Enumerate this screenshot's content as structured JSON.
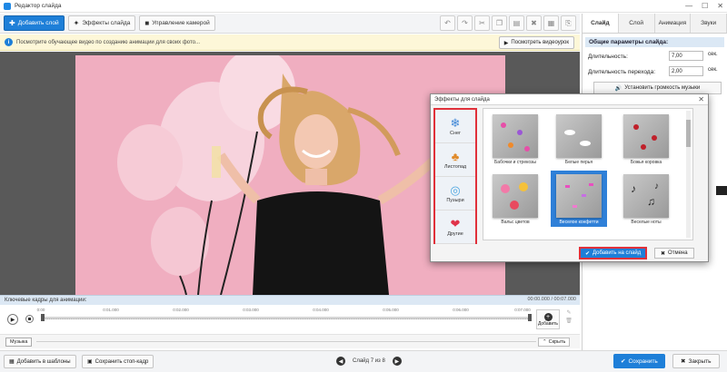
{
  "window": {
    "title": "Редактор слайда",
    "controls": [
      "—",
      "☐",
      "✕"
    ]
  },
  "toolbar": {
    "add_layer": "Добавить слой",
    "slide_effects": "Эффекты слайда",
    "camera_control": "Управление камерой"
  },
  "infobar": {
    "text": "Посмотрите обучающее видео по созданию анимации для своих фото...",
    "watch_video": "Посмотреть видеоурок"
  },
  "effects_dialog": {
    "title": "Эффекты для слайда",
    "categories": [
      {
        "label": "Снег",
        "icon": "snowflake-icon",
        "glyph": "❄",
        "color": "#3f86d6"
      },
      {
        "label": "Листопад",
        "icon": "leaf-icon",
        "glyph": "🍁",
        "color": "#e08a2a"
      },
      {
        "label": "Пузыри",
        "icon": "bubbles-icon",
        "glyph": "◎",
        "color": "#4fa7e0"
      },
      {
        "label": "Другие",
        "icon": "heart-icon",
        "glyph": "❤",
        "color": "#e0334a"
      }
    ],
    "effects": [
      {
        "label": "Бабочки и стрекозы"
      },
      {
        "label": "Белые перья"
      },
      {
        "label": "Божья коровка"
      },
      {
        "label": "Вальс цветов"
      },
      {
        "label": "Веселое конфетти"
      },
      {
        "label": "Веселые ноты"
      }
    ],
    "add_button": "Добавить на слайд",
    "cancel_button": "Отмена"
  },
  "keyframes": {
    "label": "Ключевые кадры для анимации:",
    "time": "00:00.000 / 00:07.000",
    "ticks": [
      "0:00",
      "0:01.000",
      "0:02.000",
      "0:03.000",
      "0:04.000",
      "0:05.000",
      "0:06.000",
      "0:07.000"
    ],
    "add_label": "Добавить"
  },
  "music": {
    "tag": "Музыка",
    "hide": "Скрыть"
  },
  "bottom": {
    "add_to_templates": "Добавить в шаблоны",
    "save_still": "Сохранить стоп-кадр",
    "slide_counter": "Слайд 7 из 8",
    "save": "Сохранить",
    "close": "Закрыть"
  },
  "right_panel": {
    "tabs": [
      "Слайд",
      "Слой",
      "Анимация",
      "Звуки"
    ],
    "section_title": "Общие параметры слайда:",
    "duration_label": "Длительность:",
    "duration_value": "7,00",
    "transition_label": "Длительность перехода:",
    "transition_value": "2,00",
    "unit": "сек.",
    "music_volume": "Установить громкость музыки"
  }
}
